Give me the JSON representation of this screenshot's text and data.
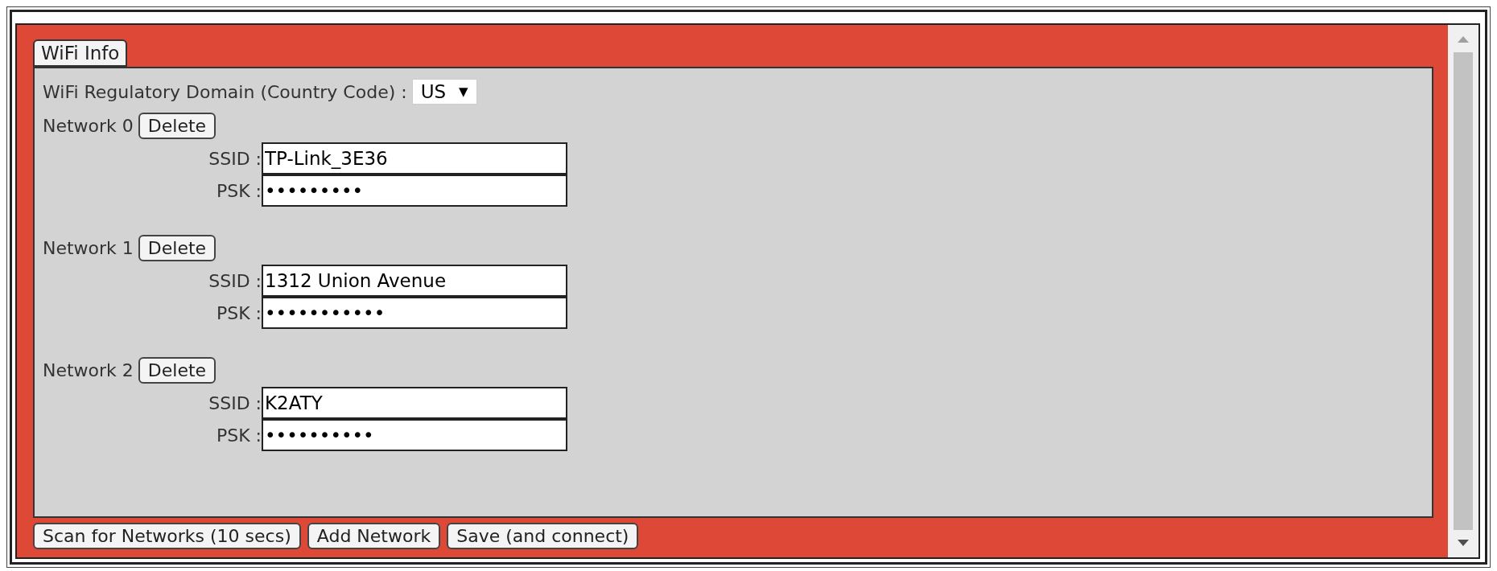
{
  "tab": {
    "label": "WiFi Info",
    "selected": true
  },
  "domain": {
    "label": "WiFi Regulatory Domain (Country Code) :",
    "value": "US",
    "arrow": "▼"
  },
  "networks": [
    {
      "label": "Network 0",
      "delete": "Delete",
      "fields": [
        {
          "label": "SSID :",
          "value": "TP-Link_3E36"
        },
        {
          "label": "PSK :",
          "value": "•••••••••"
        }
      ]
    },
    {
      "label": "Network 1",
      "delete": "Delete",
      "fields": [
        {
          "label": "SSID :",
          "value": "1312 Union Avenue"
        },
        {
          "label": "PSK :",
          "value": "•••••••••••"
        }
      ]
    },
    {
      "label": "Network 2",
      "delete": "Delete",
      "fields": [
        {
          "label": "SSID :",
          "value": "K2ATY"
        },
        {
          "label": "PSK :",
          "value": "••••••••••"
        }
      ]
    }
  ],
  "buttons": [
    "Scan for Networks (10 secs)",
    "Add Network",
    "Save (and connect)"
  ]
}
